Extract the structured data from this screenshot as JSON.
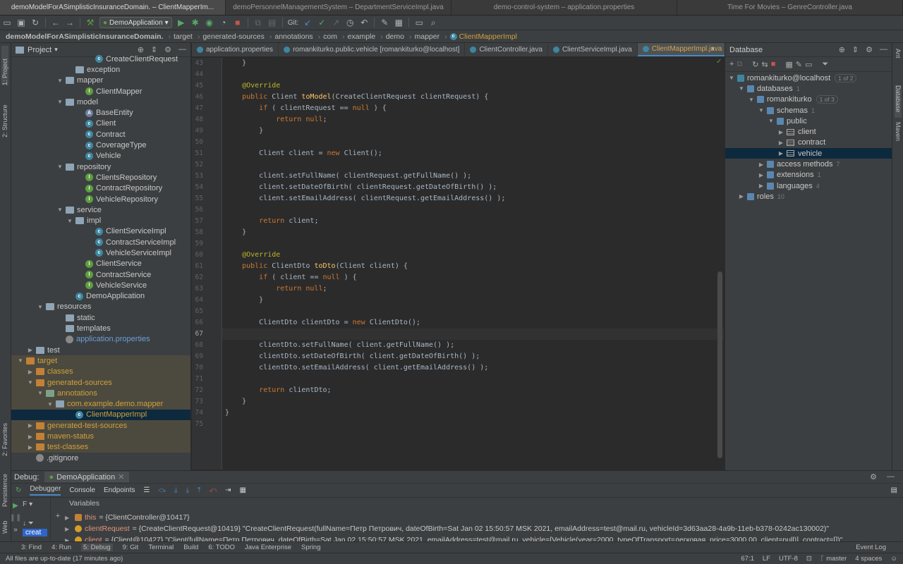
{
  "window_tabs": [
    "demoModelForASimplisticInsuranceDomain. – ClientMapperIm...",
    "demoPersonnelManagementSystem – DepartmentServiceImpl.java",
    "demo-control-system – application.properties",
    "Time For Movies – GenreController.java"
  ],
  "toolbar": {
    "run_config": "DemoApplication",
    "git_label": "Git:"
  },
  "breadcrumb": [
    "demoModelForASimplisticInsuranceDomain.",
    "target",
    "generated-sources",
    "annotations",
    "com",
    "example",
    "demo",
    "mapper",
    "ClientMapperImpl"
  ],
  "left_stripe": {
    "project": "1: Project",
    "structure": "2: Structure",
    "favorites": "2: Favorites",
    "persistence": "Persistence",
    "web": "Web"
  },
  "right_stripe": {
    "ant": "Ant",
    "database": "Database",
    "maven": "Maven"
  },
  "project": {
    "title": "Project",
    "tree": [
      {
        "label": "CreateClientRequest",
        "depth": 8,
        "icon": "c"
      },
      {
        "label": "exception",
        "depth": 6,
        "icon": "folder"
      },
      {
        "label": "mapper",
        "depth": 5,
        "icon": "folder",
        "open": true
      },
      {
        "label": "ClientMapper",
        "depth": 7,
        "icon": "i"
      },
      {
        "label": "model",
        "depth": 5,
        "icon": "folder",
        "open": true
      },
      {
        "label": "BaseEntity",
        "depth": 7,
        "icon": "e"
      },
      {
        "label": "Client",
        "depth": 7,
        "icon": "c"
      },
      {
        "label": "Contract",
        "depth": 7,
        "icon": "c"
      },
      {
        "label": "CoverageType",
        "depth": 7,
        "icon": "c"
      },
      {
        "label": "Vehicle",
        "depth": 7,
        "icon": "c"
      },
      {
        "label": "repository",
        "depth": 5,
        "icon": "folder",
        "open": true
      },
      {
        "label": "ClientsRepository",
        "depth": 7,
        "icon": "i"
      },
      {
        "label": "ContractRepository",
        "depth": 7,
        "icon": "i"
      },
      {
        "label": "VehicleRepository",
        "depth": 7,
        "icon": "i"
      },
      {
        "label": "service",
        "depth": 5,
        "icon": "folder",
        "open": true
      },
      {
        "label": "impl",
        "depth": 6,
        "icon": "folder",
        "open": true
      },
      {
        "label": "ClientServiceImpl",
        "depth": 8,
        "icon": "c"
      },
      {
        "label": "ContractServiceImpl",
        "depth": 8,
        "icon": "c"
      },
      {
        "label": "VehicleServiceImpl",
        "depth": 8,
        "icon": "c"
      },
      {
        "label": "ClientService",
        "depth": 7,
        "icon": "i"
      },
      {
        "label": "ContractService",
        "depth": 7,
        "icon": "i"
      },
      {
        "label": "VehicleService",
        "depth": 7,
        "icon": "i"
      },
      {
        "label": "DemoApplication",
        "depth": 6,
        "icon": "c"
      },
      {
        "label": "resources",
        "depth": 3,
        "icon": "folder",
        "open": true
      },
      {
        "label": "static",
        "depth": 5,
        "icon": "folder"
      },
      {
        "label": "templates",
        "depth": 5,
        "icon": "folder"
      },
      {
        "label": "application.properties",
        "depth": 5,
        "icon": "f",
        "color": "blue"
      },
      {
        "label": "test",
        "depth": 2,
        "icon": "folder",
        "closed": true
      },
      {
        "label": "target",
        "depth": 1,
        "icon": "folder-o",
        "open": true,
        "hl": true
      },
      {
        "label": "classes",
        "depth": 2,
        "icon": "folder-o",
        "closed": true,
        "hl": true
      },
      {
        "label": "generated-sources",
        "depth": 2,
        "icon": "folder-o",
        "open": true,
        "hl": true
      },
      {
        "label": "annotations",
        "depth": 3,
        "icon": "folder-r",
        "open": true,
        "hl": true
      },
      {
        "label": "com.example.demo.mapper",
        "depth": 4,
        "icon": "folder",
        "open": true,
        "hl": true
      },
      {
        "label": "ClientMapperImpl",
        "depth": 6,
        "icon": "c",
        "sel": true
      },
      {
        "label": "generated-test-sources",
        "depth": 2,
        "icon": "folder-o",
        "closed": true,
        "hl": true
      },
      {
        "label": "maven-status",
        "depth": 2,
        "icon": "folder-o",
        "closed": true,
        "hl": true
      },
      {
        "label": "test-classes",
        "depth": 2,
        "icon": "folder-o",
        "closed": true,
        "hl": true
      },
      {
        "label": ".gitignore",
        "depth": 2,
        "icon": "f"
      }
    ]
  },
  "editor_tabs": [
    {
      "label": "application.properties",
      "active": false
    },
    {
      "label": "romankiturko.public.vehicle [romankiturko@localhost]",
      "active": false
    },
    {
      "label": "ClientController.java",
      "active": false
    },
    {
      "label": "ClientServiceImpl.java",
      "active": false
    },
    {
      "label": "ClientMapperImpl.java",
      "active": true
    }
  ],
  "code": {
    "line_numbers": [
      "43",
      "44",
      "45",
      "46",
      "47",
      "48",
      "49",
      "50",
      "51",
      "52",
      "53",
      "54",
      "55",
      "56",
      "57",
      "58",
      "59",
      "60",
      "61",
      "62",
      "63",
      "64",
      "65",
      "66",
      "67",
      "68",
      "69",
      "70",
      "71",
      "72",
      "73",
      "74",
      "75"
    ],
    "current_line_index": 24
  },
  "database": {
    "title": "Database",
    "tree": [
      {
        "label": "romankiturko@localhost",
        "badge": "1 of 2",
        "depth": 0,
        "open": true
      },
      {
        "label": "databases",
        "count": "1",
        "depth": 1,
        "open": true
      },
      {
        "label": "romankiturko",
        "badge": "1 of 3",
        "depth": 2,
        "open": true
      },
      {
        "label": "schemas",
        "count": "1",
        "depth": 3,
        "open": true
      },
      {
        "label": "public",
        "depth": 4,
        "open": true
      },
      {
        "label": "client",
        "depth": 5,
        "table": true
      },
      {
        "label": "contract",
        "depth": 5,
        "table": true
      },
      {
        "label": "vehicle",
        "depth": 5,
        "table": true,
        "sel": true
      },
      {
        "label": "access methods",
        "count": "7",
        "depth": 3
      },
      {
        "label": "extensions",
        "count": "1",
        "depth": 3
      },
      {
        "label": "languages",
        "count": "4",
        "depth": 3
      },
      {
        "label": "roles",
        "count": "10",
        "depth": 1
      }
    ]
  },
  "debug": {
    "title": "Debug:",
    "config": "DemoApplication",
    "tabs": [
      "Debugger",
      "Console",
      "Endpoints"
    ],
    "variables_header": "Variables",
    "frame_label": "F",
    "frame_value": "creat",
    "vars": [
      {
        "name": "this",
        "value": "= {ClientController@10417}"
      },
      {
        "name": "clientRequest",
        "value": "= {CreateClientRequest@10419} \"CreateClientRequest(fullName=Петр Петрович, dateOfBirth=Sat Jan 02 15:50:57 MSK 2021, emailAddress=test@mail.ru, vehicleId=3d63aa28-4a9b-11eb-b378-0242ac130002)\""
      },
      {
        "name": "client",
        "value": "= {Client@10427} \"Client(fullName=Петр Петрович, dateOfBirth=Sat Jan 02 15:50:57 MSK 2021, emailAddress=test@mail.ru, vehicle=[Vehicle(year=2000, typeOfTransport=легковая, price=3000.00, client=null)], contract=[])\""
      }
    ]
  },
  "bottom_tools": [
    "3: Find",
    "4: Run",
    "5: Debug",
    "9: Git",
    "Terminal",
    "Build",
    "6: TODO",
    "Java Enterprise",
    "Spring"
  ],
  "event_log": "Event Log",
  "status": {
    "message": "All files are up-to-date (17 minutes ago)",
    "position": "67:1",
    "line_sep": "LF",
    "encoding": "UTF-8",
    "branch": "master",
    "indent": "4 spaces"
  }
}
